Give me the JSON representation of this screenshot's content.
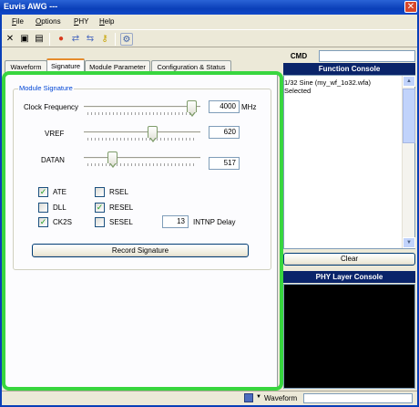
{
  "window": {
    "title": "Euvis AWG ---",
    "close_glyph": "✕"
  },
  "menu": [
    {
      "accel": "F",
      "rest": "ile"
    },
    {
      "accel": "O",
      "rest": "ptions"
    },
    {
      "accel": "P",
      "rest": "HY"
    },
    {
      "accel": "H",
      "rest": "elp"
    }
  ],
  "toolbar": {
    "icons": [
      "cut-icon",
      "save-icon",
      "save-all-icon",
      "stop-icon",
      "connect-icon",
      "disconnect-icon",
      "key-icon",
      "settings-icon"
    ],
    "glyphs": {
      "cut": "✕",
      "save": "▣",
      "saveall": "▤",
      "stop": "●",
      "connect": "⇄",
      "disconnect": "⇆",
      "key": "⚷",
      "settings": "⚙"
    }
  },
  "tabs": [
    "Waveform",
    "Signature",
    "Module Parameter",
    "Configuration & Status"
  ],
  "active_tab": "Signature",
  "signature": {
    "group_title": "Module Signature",
    "sliders": [
      {
        "label": "Clock Frequency",
        "value": "4000",
        "unit": "MHz",
        "fraction": 0.97
      },
      {
        "label": "VREF",
        "value": "620",
        "unit": "",
        "fraction": 0.6
      },
      {
        "label": "DATAN",
        "value": "517",
        "unit": "",
        "fraction": 0.22
      }
    ],
    "checkboxes": [
      {
        "label": "ATE",
        "checked": true
      },
      {
        "label": "RSEL",
        "checked": false
      },
      {
        "label": "DLL",
        "checked": false
      },
      {
        "label": "RESEL",
        "checked": true
      },
      {
        "label": "CK2S",
        "checked": true
      },
      {
        "label": "SESEL",
        "checked": false
      }
    ],
    "delay_value": "13",
    "delay_label": "INTNP Delay",
    "record_button": "Record Signature",
    "check_glyph": "✓"
  },
  "right": {
    "cmd_label": "CMD",
    "cmd_value": "",
    "function_console_title": "Function Console",
    "function_console_lines": [
      "1/32 Sine (my_wf_1o32.wfa)",
      "Selected"
    ],
    "clear_button": "Clear",
    "phy_console_title": "PHY Layer Console",
    "scroll_up": "▲",
    "scroll_down": "▼"
  },
  "status": {
    "left_text": "",
    "waveform_label": "Waveform",
    "dropdown_glyph": "▼"
  },
  "colors": {
    "highlight": "#38d63f",
    "title_bar": "#0a3fb8",
    "console_header": "#0a246a",
    "group_title": "#0046d5"
  }
}
